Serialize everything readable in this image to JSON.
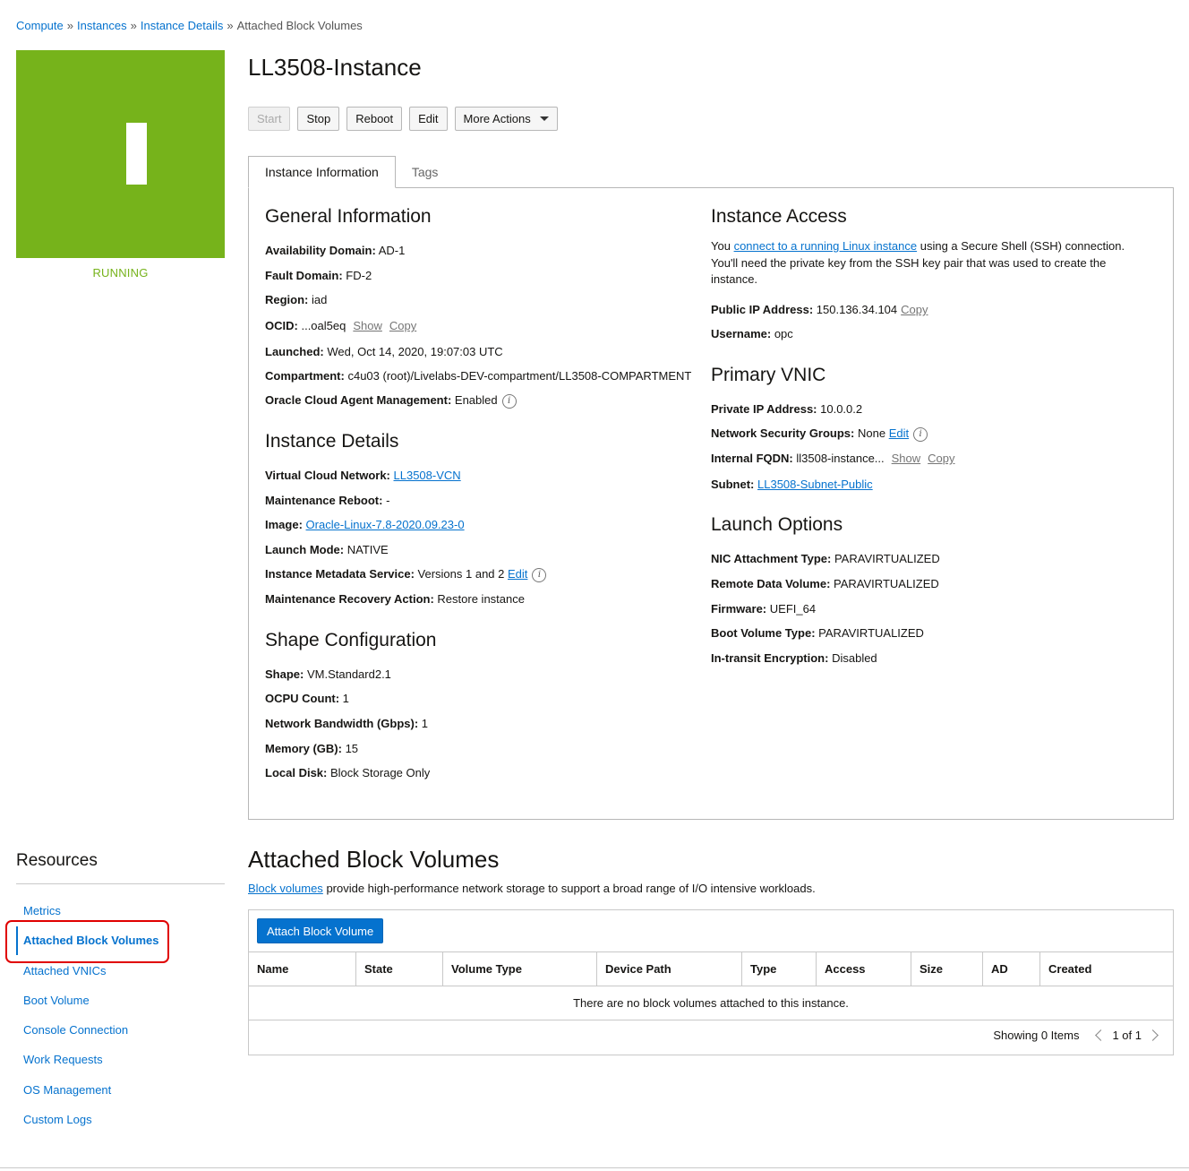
{
  "breadcrumb": {
    "items": [
      "Compute",
      "Instances",
      "Instance Details"
    ],
    "current": "Attached Block Volumes",
    "separator": "»"
  },
  "instance": {
    "status": "RUNNING",
    "title": "LL3508-Instance",
    "status_color": "#76b31b"
  },
  "actions": {
    "start": "Start",
    "stop": "Stop",
    "reboot": "Reboot",
    "edit": "Edit",
    "more": "More Actions"
  },
  "tabs": {
    "info": "Instance Information",
    "tags": "Tags"
  },
  "general": {
    "title": "General Information",
    "availability_domain_label": "Availability Domain:",
    "availability_domain": "AD-1",
    "fault_domain_label": "Fault Domain:",
    "fault_domain": "FD-2",
    "region_label": "Region:",
    "region": "iad",
    "ocid_label": "OCID:",
    "ocid": "...oal5eq",
    "show": "Show",
    "copy": "Copy",
    "launched_label": "Launched:",
    "launched": "Wed, Oct 14, 2020, 19:07:03 UTC",
    "compartment_label": "Compartment:",
    "compartment": "c4u03 (root)/Livelabs-DEV-compartment/LL3508-COMPARTMENT",
    "agent_label": "Oracle Cloud Agent Management:",
    "agent": "Enabled"
  },
  "details": {
    "title": "Instance Details",
    "vcn_label": "Virtual Cloud Network:",
    "vcn": "LL3508-VCN",
    "maint_reboot_label": "Maintenance Reboot:",
    "maint_reboot": "-",
    "image_label": "Image:",
    "image": "Oracle-Linux-7.8-2020.09.23-0",
    "launch_mode_label": "Launch Mode:",
    "launch_mode": "NATIVE",
    "metadata_label": "Instance Metadata Service:",
    "metadata": "Versions 1 and 2",
    "edit": "Edit",
    "recovery_label": "Maintenance Recovery Action:",
    "recovery": "Restore instance"
  },
  "shape": {
    "title": "Shape Configuration",
    "shape_label": "Shape:",
    "shape": "VM.Standard2.1",
    "ocpu_label": "OCPU Count:",
    "ocpu": "1",
    "bandwidth_label": "Network Bandwidth (Gbps):",
    "bandwidth": "1",
    "memory_label": "Memory (GB):",
    "memory": "15",
    "disk_label": "Local Disk:",
    "disk": "Block Storage Only"
  },
  "access": {
    "title": "Instance Access",
    "text_pre": "You",
    "link": "connect to a running Linux instance",
    "text_post": "using a Secure Shell (SSH) connection. You'll need the private key from the SSH key pair that was used to create the instance.",
    "public_ip_label": "Public IP Address:",
    "public_ip": "150.136.34.104",
    "copy": "Copy",
    "username_label": "Username:",
    "username": "opc"
  },
  "vnic": {
    "title": "Primary VNIC",
    "private_ip_label": "Private IP Address:",
    "private_ip": "10.0.0.2",
    "nsg_label": "Network Security Groups:",
    "nsg": "None",
    "edit": "Edit",
    "fqdn_label": "Internal FQDN:",
    "fqdn": "ll3508-instance...",
    "show": "Show",
    "copy": "Copy",
    "subnet_label": "Subnet:",
    "subnet": "LL3508-Subnet-Public"
  },
  "launch": {
    "title": "Launch Options",
    "nic_label": "NIC Attachment Type:",
    "nic": "PARAVIRTUALIZED",
    "remote_label": "Remote Data Volume:",
    "remote": "PARAVIRTUALIZED",
    "firmware_label": "Firmware:",
    "firmware": "UEFI_64",
    "boot_label": "Boot Volume Type:",
    "boot": "PARAVIRTUALIZED",
    "transit_label": "In-transit Encryption:",
    "transit": "Disabled"
  },
  "resources": {
    "title": "Resources",
    "items": [
      "Metrics",
      "Attached Block Volumes",
      "Attached VNICs",
      "Boot Volume",
      "Console Connection",
      "Work Requests",
      "OS Management",
      "Custom Logs"
    ]
  },
  "abv": {
    "title": "Attached Block Volumes",
    "desc_link": "Block volumes",
    "desc": "provide high-performance network storage to support a broad range of I/O intensive workloads.",
    "attach_button": "Attach Block Volume",
    "columns": [
      "Name",
      "State",
      "Volume Type",
      "Device Path",
      "Type",
      "Access",
      "Size",
      "AD",
      "Created"
    ],
    "empty": "There are no block volumes attached to this instance.",
    "showing": "Showing 0 Items",
    "page": "1 of 1"
  }
}
